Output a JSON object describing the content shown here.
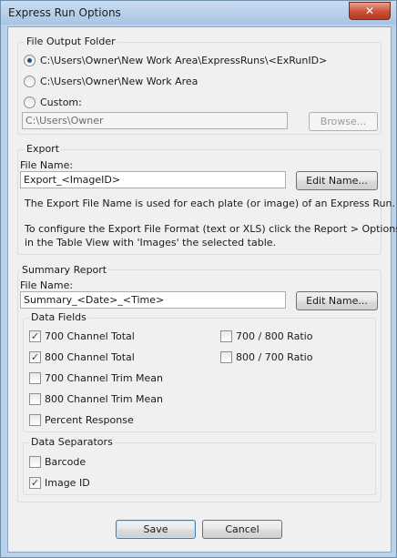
{
  "window": {
    "title": "Express Run Options",
    "close_glyph": "✕"
  },
  "output_folder": {
    "legend": "File Output Folder",
    "options": [
      {
        "label": "C:\\Users\\Owner\\New Work Area\\ExpressRuns\\<ExRunID>",
        "selected": true
      },
      {
        "label": "C:\\Users\\Owner\\New Work Area",
        "selected": false
      },
      {
        "label": "Custom:",
        "selected": false
      }
    ],
    "custom_path": "C:\\Users\\Owner",
    "browse_label": "Browse..."
  },
  "export": {
    "legend": "Export",
    "file_name_label": "File Name:",
    "file_name_value": "Export_<ImageID>",
    "edit_name_label": "Edit Name...",
    "note1": "The Export File Name is used for each plate (or image) of an Express Run.",
    "note2_line1": "To configure the Export File Format (text or XLS) click the Report > Options",
    "note2_line2": "in the Table View with 'Images' the selected table."
  },
  "summary": {
    "legend": "Summary Report",
    "file_name_label": "File Name:",
    "file_name_value": "Summary_<Date>_<Time>",
    "edit_name_label": "Edit Name...",
    "data_fields": {
      "legend": "Data Fields",
      "items": [
        {
          "label": "700 Channel Total",
          "checked": true
        },
        {
          "label": "800 Channel Total",
          "checked": true
        },
        {
          "label": "700 Channel Trim Mean",
          "checked": false
        },
        {
          "label": "800 Channel Trim Mean",
          "checked": false
        },
        {
          "label": "Percent Response",
          "checked": false
        },
        {
          "label": "700 / 800 Ratio",
          "checked": false
        },
        {
          "label": "800 / 700 Ratio",
          "checked": false
        }
      ]
    },
    "data_separators": {
      "legend": "Data Separators",
      "items": [
        {
          "label": "Barcode",
          "checked": false
        },
        {
          "label": "Image ID",
          "checked": true
        }
      ]
    }
  },
  "footer": {
    "save_label": "Save",
    "cancel_label": "Cancel"
  },
  "icons": {
    "radio": "radio-dot-icon",
    "check": "checkmark-icon"
  }
}
